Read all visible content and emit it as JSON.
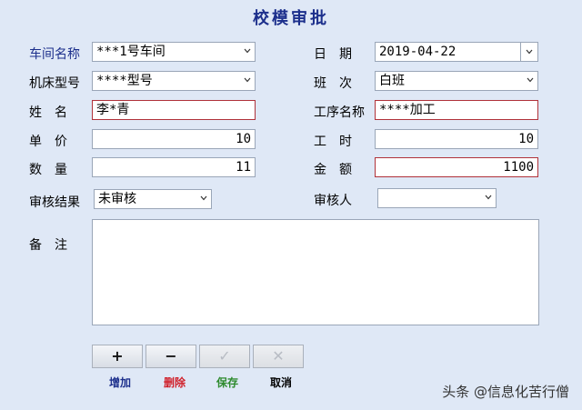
{
  "window": {
    "title": "校模审批"
  },
  "form": {
    "workshop": {
      "label": "车间名称",
      "value": "***1号车间"
    },
    "date": {
      "label": "日　期",
      "value": "2019-04-22"
    },
    "machine_model": {
      "label": "机床型号",
      "value": "****型号"
    },
    "shift": {
      "label": "班　次",
      "value": "白班"
    },
    "name": {
      "label": "姓　名",
      "value": "李*青"
    },
    "process_name": {
      "label": "工序名称",
      "value": "****加工"
    },
    "unit_price": {
      "label": "单　价",
      "value": "10"
    },
    "work_hours": {
      "label": "工　时",
      "value": "10"
    },
    "quantity": {
      "label": "数　量",
      "value": "11"
    },
    "amount": {
      "label": "金　额",
      "value": "1100"
    },
    "review_result": {
      "label": "审核结果",
      "value": "未审核"
    },
    "reviewer": {
      "label": "审核人",
      "value": ""
    },
    "remarks": {
      "label": "备　注",
      "value": ""
    }
  },
  "toolbar": {
    "add": {
      "symbol": "+",
      "label": "增加",
      "color": "#1c2f8c"
    },
    "delete": {
      "symbol": "−",
      "label": "删除",
      "color": "#d0202a"
    },
    "save": {
      "symbol": "✓",
      "label": "保存",
      "color": "#2e8b2e"
    },
    "cancel": {
      "symbol": "✕",
      "label": "取消",
      "color": "#000000"
    }
  },
  "watermark": "头条 @信息化苦行僧"
}
